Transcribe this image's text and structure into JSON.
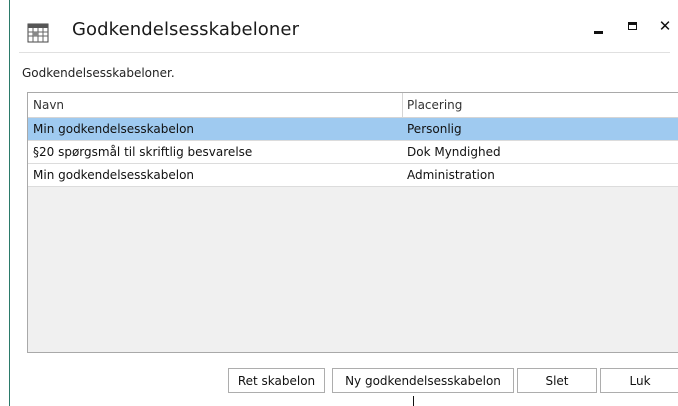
{
  "window": {
    "title": "Godkendelsesskabeloner",
    "icon": "calendar-grid-icon",
    "controls": {
      "minimize": "minimize-icon",
      "maximize": "maximize-icon",
      "close_glyph": "✕"
    }
  },
  "description": "Godkendelsesskabeloner.",
  "grid": {
    "columns": [
      "Navn",
      "Placering"
    ],
    "rows": [
      {
        "navn": "Min godkendelsesskabelon",
        "placering": "Personlig",
        "selected": true
      },
      {
        "navn": "§20 spørgsmål til skriftlig besvarelse",
        "placering": "Dok Myndighed",
        "selected": false
      },
      {
        "navn": "Min godkendelsesskabelon",
        "placering": "Administration",
        "selected": false
      }
    ],
    "selected_color": "#9fcaf0"
  },
  "buttons": {
    "ret": "Ret skabelon",
    "ny": "Ny godkendelsesskabelon",
    "slet": "Slet",
    "luk": "Luk"
  },
  "colors": {
    "window_border": "#2b7a6a",
    "selection": "#9fcaf0"
  }
}
